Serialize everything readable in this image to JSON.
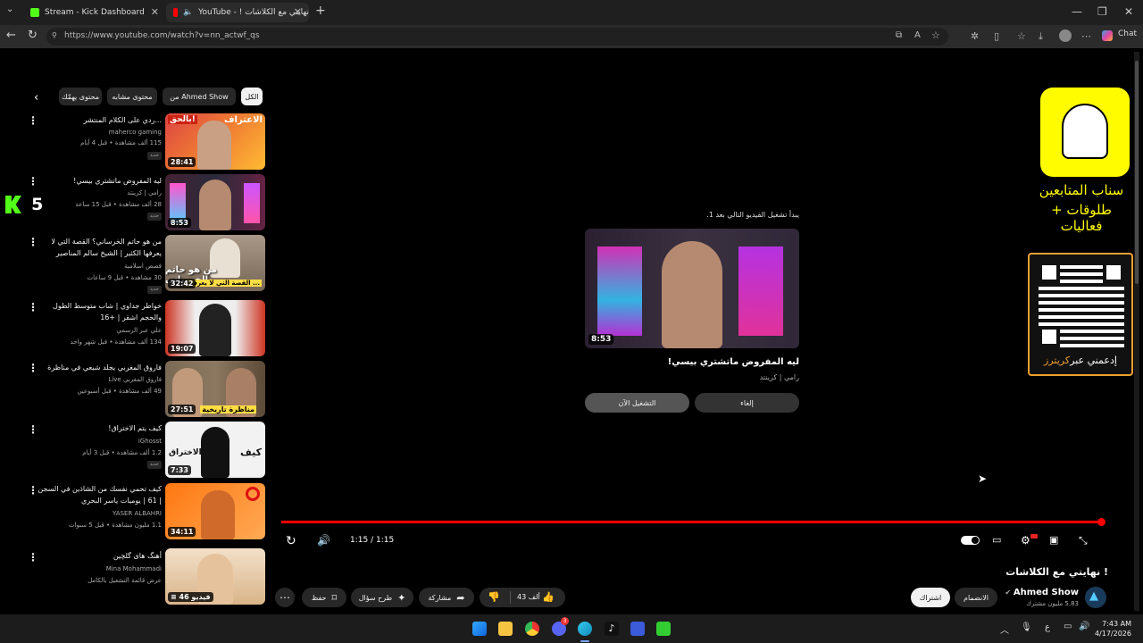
{
  "browser": {
    "tabs": [
      {
        "label": "Stream - Kick Dashboard",
        "active": false
      },
      {
        "label": "YouTube - ! نهايتي مع الكلاشات",
        "active": true
      }
    ],
    "url": "https://www.youtube.com/watch?v=nn_actwf_qs",
    "chat_label": "Chat"
  },
  "colors": {
    "accent": "#ff0000",
    "kick_green": "#53fc18",
    "snap_yellow": "#fffc00"
  },
  "chips": [
    {
      "label": "الكل",
      "active": true
    },
    {
      "label": "من Ahmed Show",
      "active": false
    },
    {
      "label": "محتوى مشابه",
      "active": false
    },
    {
      "label": "محتوى يهمّك",
      "active": false
    }
  ],
  "sidebar": [
    {
      "title": "...ردي على الكلام المنتشر",
      "channel": "maherco gaming",
      "meta": "115 ألف مشاهدة • قبل 4 أيام",
      "badge": "جديد",
      "duration": "28:41"
    },
    {
      "title": "ليه المفروض ماتشتري بيسي!",
      "channel": "رامي | كرينتد",
      "meta": "28 ألف مشاهدة • قبل 15 ساعة",
      "badge": "جديد",
      "duration": "8:53"
    },
    {
      "title": "من هو حاتم الخرساني؟ القصة التي لا يعرفها الكثير | الشيخ سالم المناصير",
      "channel": "قصص اسلامية",
      "meta": "30 مشاهدة • قبل 9 ساعات",
      "badge": "جديد",
      "duration": "32:42"
    },
    {
      "title": "خواطر جداوي | شاب متوسط الطول والحجم اشقر | +16",
      "channel": "علي عبر الرسمي",
      "meta": "134 ألف مشاهدة • قبل شهر واحد",
      "badge": "",
      "duration": "19:07"
    },
    {
      "title": "فاروق المغربي يجلد شيعي في مناظرة",
      "channel": "فاروق المغربي Live",
      "meta": "49 ألف مشاهدة • قبل أسبوعين",
      "badge": "",
      "duration": "27:51"
    },
    {
      "title": "كيف يتم الاختراق!",
      "channel": "iGhosst",
      "meta": "1.2 ألف مشاهدة • قبل 3 أيام",
      "badge": "جديد",
      "duration": "7:33"
    },
    {
      "title": "كيف تحمي نفسك من الشاذين في السجن | 61 | يوميات ياسر البحري",
      "channel": "YASER ALBAHRI",
      "meta": "1.1 مليون مشاهدة • قبل 5 سنوات",
      "badge": "",
      "duration": "34:11"
    },
    {
      "title": "أهنگ های گلچین",
      "channel": "Mina Mohammadi",
      "meta": "عرض قائمة التشغيل بالكامل",
      "badge": "",
      "duration": "46 فيديو"
    }
  ],
  "thumb_texts": {
    "t1_main": "الاعتراف",
    "t1_sub": "بالحق!",
    "t3_main": "من هو حاتم الخرساني",
    "t3_sub": "القصة التي لا يعرفها ...",
    "t5_sub": "مناظرة تاريخية",
    "t6_left": "الاختراق",
    "t6_right": "كيف"
  },
  "kick_overlay": {
    "count": "5"
  },
  "snap_overlay": {
    "line1": "سناب المتابعين",
    "line2": "طلوقات + فعاليات"
  },
  "qr_overlay": {
    "label_prefix": "إدعمني عبر",
    "label_brand": "كريترز"
  },
  "endscreen": {
    "countdown": "يبدأ تشغيل الفيديو التالي بعد 1.",
    "duration": "8:53",
    "title": "ليه المفروض ماتشتري بيسي!",
    "channel": "رامي | كرينتد",
    "play_now": "التشغيل الآن",
    "cancel": "إلغاء"
  },
  "player": {
    "progress": 1.0,
    "time": "1:15 / 1:15"
  },
  "video": {
    "title": "! نهايتي مع الكلاشات",
    "channel": "Ahmed Show",
    "subscribers": "5.83 مليون مشترك",
    "subscribe": "اشتراك",
    "join": "الانضمام",
    "likes": "43 ألف",
    "share": "مشاركة",
    "ask": "طرح سؤال",
    "save": "حفظ"
  },
  "taskbar": {
    "time": "7:43 AM",
    "date": "4/17/2026",
    "lang": "ع",
    "badge": "3"
  }
}
